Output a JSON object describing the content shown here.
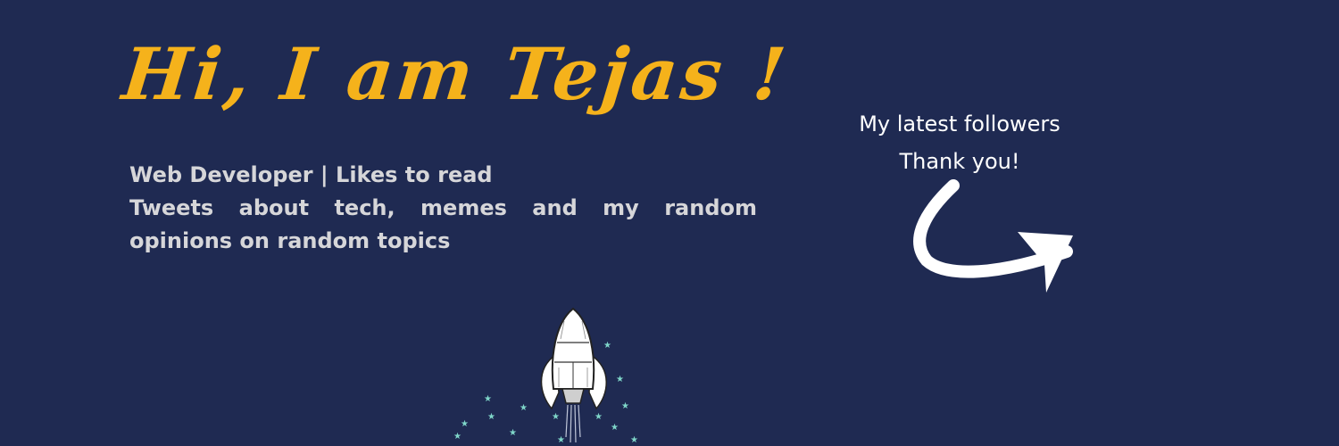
{
  "banner": {
    "headline": "Hi, I am Tejas !",
    "bio_line_1": "Web Developer | Likes to read",
    "bio_line_2": "Tweets about tech, memes and my random opinions on random topics",
    "followers_line_1": "My latest followers",
    "followers_line_2": "Thank you!"
  },
  "colors": {
    "background": "#1f2a52",
    "headline": "#f5b21b",
    "bio_text": "#d6d6d9",
    "followers_text": "#ffffff",
    "stars": "#7fd6c9"
  },
  "icons": {
    "arrow": "curved-arrow-icon",
    "rocket": "rocket-illustration"
  }
}
